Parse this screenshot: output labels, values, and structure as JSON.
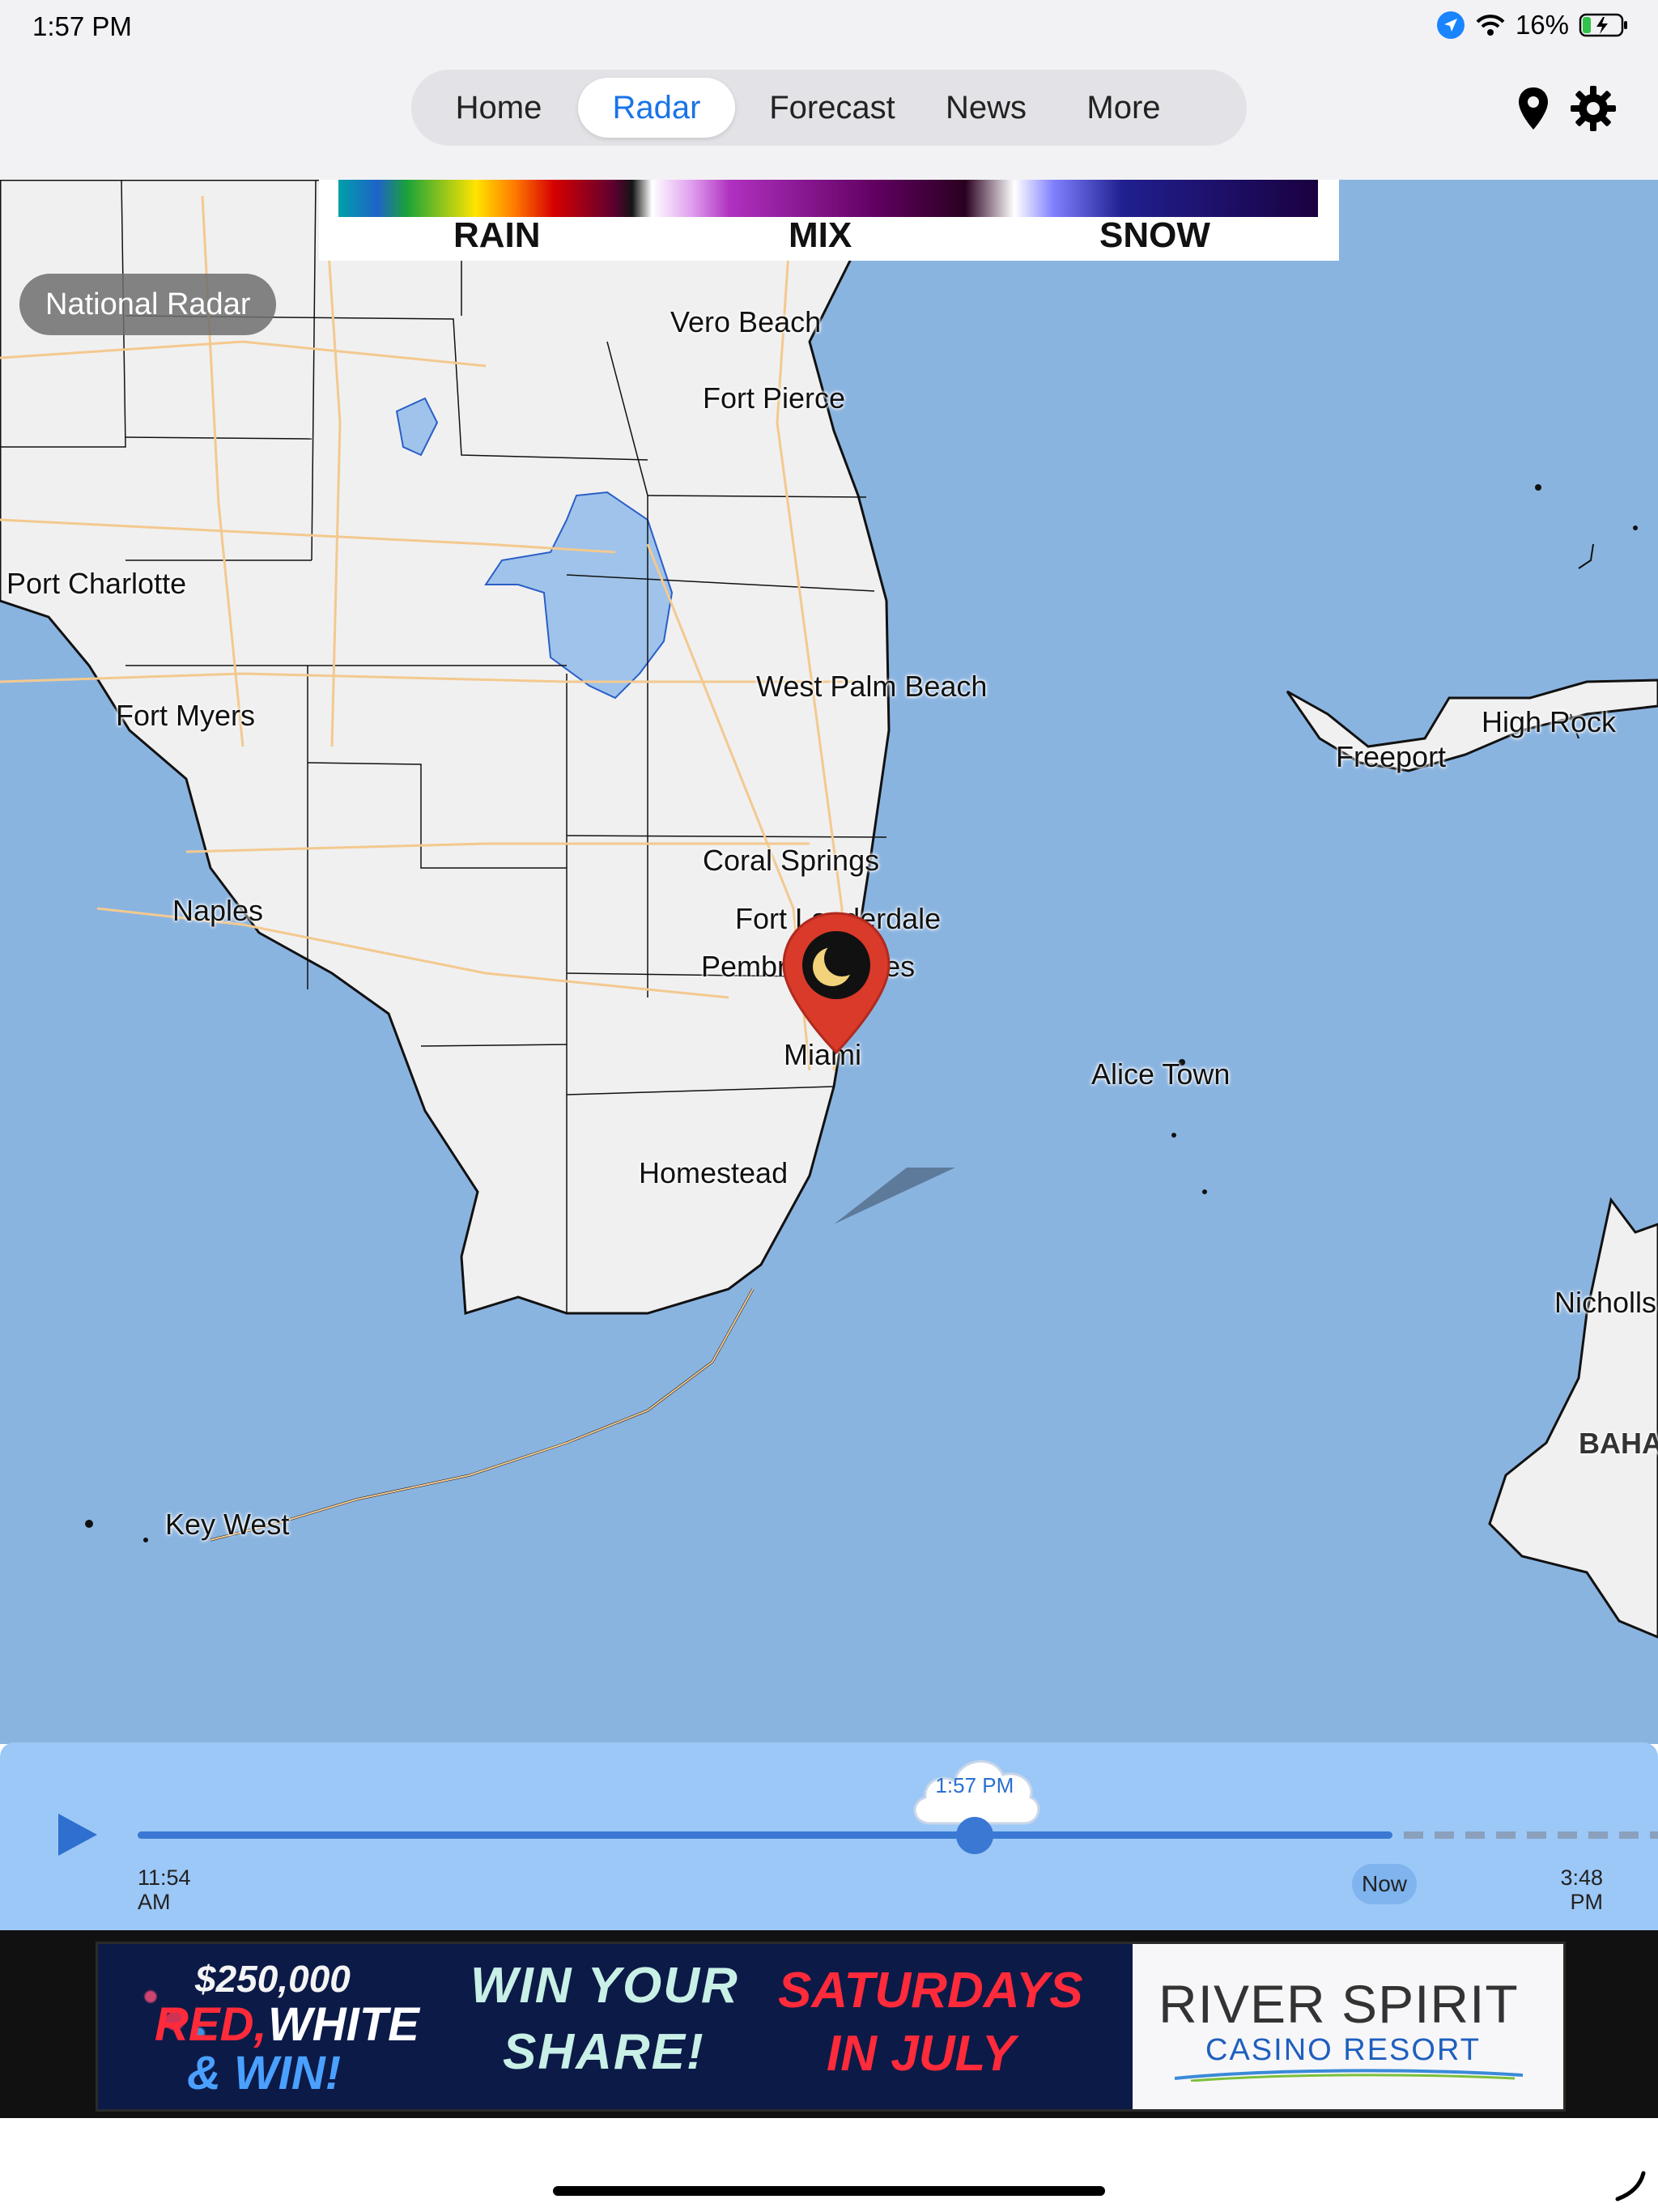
{
  "status_bar": {
    "time": "1:57 PM",
    "battery": "16%",
    "icons": [
      "location-arrow-icon",
      "wifi-icon",
      "battery-charging-icon"
    ]
  },
  "nav": {
    "tabs": [
      {
        "label": "Home",
        "active": false
      },
      {
        "label": "Radar",
        "active": true
      },
      {
        "label": "Forecast",
        "active": false
      },
      {
        "label": "News",
        "active": false
      },
      {
        "label": "More",
        "active": false
      }
    ],
    "icons": [
      "location-pin-icon",
      "gear-icon"
    ]
  },
  "legend": {
    "labels": [
      "RAIN",
      "MIX",
      "SNOW"
    ]
  },
  "region_button": "National Radar",
  "map": {
    "cities": [
      "Vero Beach",
      "Fort Pierce",
      "Port Charlotte",
      "West Palm Beach",
      "Fort Myers",
      "High Rock",
      "Freeport",
      "Coral Springs",
      "Naples",
      "Fort Lauderdale",
      "Pembroke Pines",
      "Miami",
      "Alice Town",
      "Homestead",
      "Nicholls",
      "BAHA",
      "Key West"
    ],
    "marker_icon": "moon-icon",
    "colors": {
      "water": "#8ab4e0",
      "land": "#f0f0f0",
      "lakes": "#9fc3ea",
      "roads": "#f3c98f"
    }
  },
  "timeline": {
    "current_time": "1:57 PM",
    "start_time": [
      "11:54",
      "AM"
    ],
    "now_label": "Now",
    "end_time": [
      "3:48",
      "PM"
    ],
    "progress": 0.667,
    "icons": [
      "play-icon",
      "cloud-icon"
    ]
  },
  "ad": {
    "amount": "$250,000",
    "headline_red": "RED,",
    "headline_white": "WHITE",
    "headline_win": "& WIN!",
    "cta_line1": "WIN YOUR",
    "cta_line2": "SHARE!",
    "promo_line1": "SATURDAYS",
    "promo_line2": "IN JULY",
    "brand": "RIVER SPIRIT",
    "brand_sub": "CASINO RESORT"
  }
}
